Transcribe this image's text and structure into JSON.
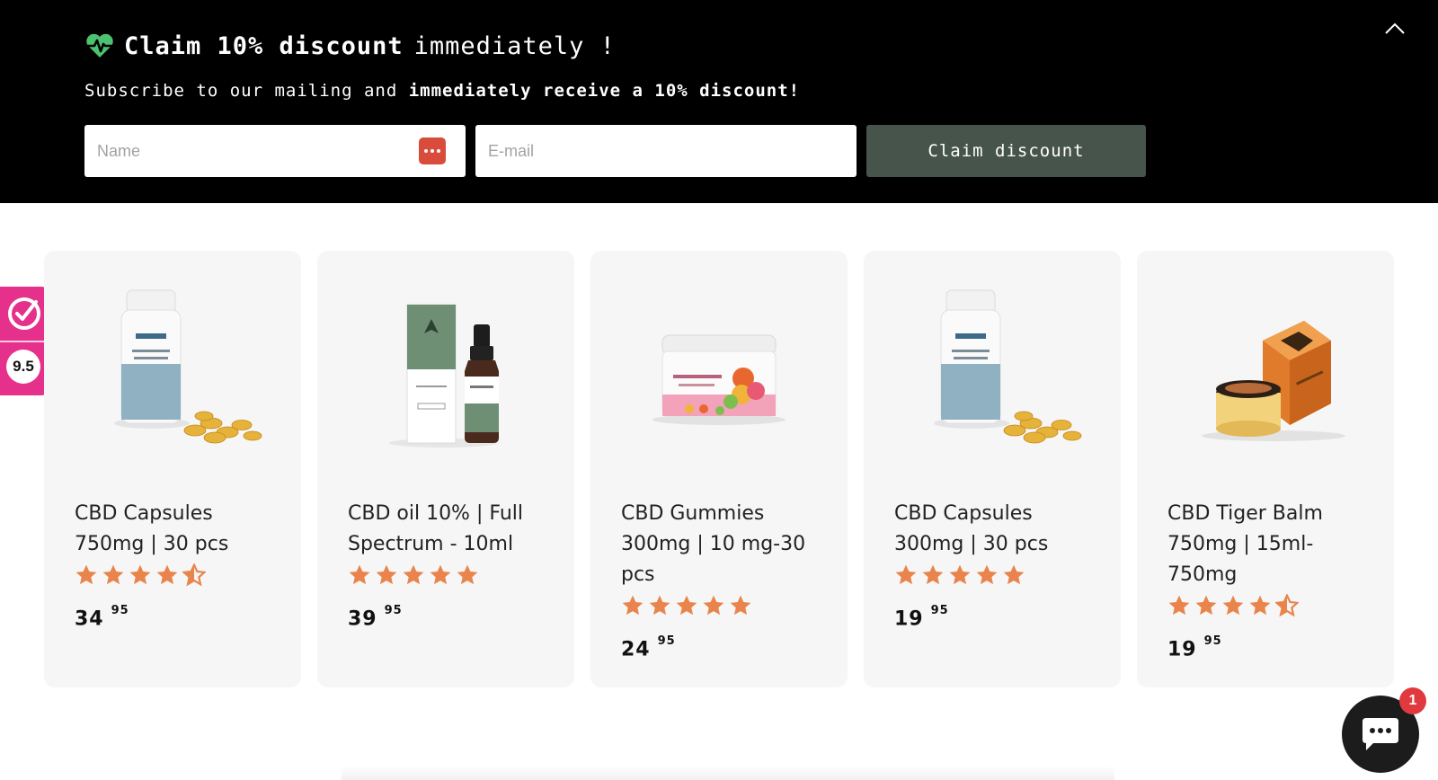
{
  "promo": {
    "title_bold": "Claim 10% discount",
    "title_light": "immediately !",
    "subtitle_light": "Subscribe to our mailing and ",
    "subtitle_bold": "immediately receive a 10% discount!",
    "name_placeholder": "Name",
    "email_placeholder": "E-mail",
    "button_label": "Claim discount",
    "heart_icon": "heart-pulse-icon",
    "collapse_icon": "chevron-up-icon",
    "colors": {
      "background": "#000000",
      "button": "#46544c",
      "heart": "#4cc16f"
    }
  },
  "products": [
    {
      "title": "CBD Capsules 750mg | 30 pcs",
      "rating": 4.5,
      "price_main": "34",
      "price_cents": "95",
      "image": "capsules-bottle"
    },
    {
      "title": "CBD oil 10% | Full Spectrum - 10ml",
      "rating": 5,
      "price_main": "39",
      "price_cents": "95",
      "image": "oil-dropper"
    },
    {
      "title": "CBD Gummies 300mg | 10 mg-30 pcs",
      "rating": 5,
      "price_main": "24",
      "price_cents": "95",
      "image": "gummies-jar"
    },
    {
      "title": "CBD Capsules 300mg | 30 pcs",
      "rating": 5,
      "price_main": "19",
      "price_cents": "95",
      "image": "capsules-bottle"
    },
    {
      "title": "CBD Tiger Balm 750mg | 15ml-750mg",
      "rating": 4.5,
      "price_main": "19",
      "price_cents": "95",
      "image": "balm-tin"
    }
  ],
  "review_badge": {
    "score": "9.5",
    "icon": "checkmark-seal-icon",
    "color": "#e5308c"
  },
  "chat": {
    "unread_count": "1",
    "icon": "chat-bubble-icon"
  },
  "colors": {
    "star": "#e9844c",
    "card_bg": "#f6f6f6"
  }
}
